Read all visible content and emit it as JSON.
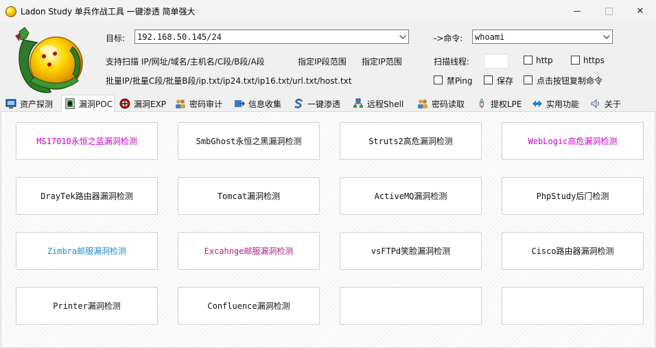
{
  "window": {
    "title": "Ladon Study 单兵作战工具 一键渗透 简单强大",
    "close_glyph": "✕"
  },
  "form": {
    "target_label": "目标:",
    "target_value": "192.168.50.145/24",
    "command_label": "->命令:",
    "command_value": "whoami",
    "support_text": "支持扫描 IP/网址/域名/主机名/C段/B段/A段",
    "ip_range_text": "指定IP段范围",
    "ip_range2_text": "指定IP范围",
    "batch_text": "批量IP/批量C段/批量B段/ip.txt/ip24.txt/ip16.txt/url.txt/host.txt",
    "threads_label": "扫描线程:",
    "http_label": "http",
    "https_label": "https",
    "noping_label": "禁Ping",
    "save_label": "保存",
    "copycmd_label": "点击按钮复制命令"
  },
  "tabs": [
    {
      "label": "资产探测",
      "icon": "monitor-icon"
    },
    {
      "label": "漏洞POC",
      "icon": "bug-icon"
    },
    {
      "label": "漏洞EXP",
      "icon": "exploit-icon"
    },
    {
      "label": "密码审计",
      "icon": "users-icon"
    },
    {
      "label": "信息收集",
      "icon": "collect-icon"
    },
    {
      "label": "一键渗透",
      "icon": "s-icon"
    },
    {
      "label": "远程Shell",
      "icon": "network-icon"
    },
    {
      "label": "密码读取",
      "icon": "users-key-icon"
    },
    {
      "label": "提权LPE",
      "icon": "rocket-icon"
    },
    {
      "label": "实用功能",
      "icon": "tools-icon"
    },
    {
      "label": "关于",
      "icon": "speaker-icon"
    }
  ],
  "colors": {
    "magenta": "#cc00cc",
    "purple": "#8a2be2",
    "cyan": "#1e90c8",
    "red_violet": "#b0208a"
  },
  "buttons": [
    {
      "label": "MS17010永恒之蓝漏洞检测",
      "color": "#cc00cc"
    },
    {
      "label": "SmbGhost永恒之黑漏洞检测",
      "color": "#111111"
    },
    {
      "label": "Struts2高危漏洞检测",
      "color": "#111111"
    },
    {
      "label": "WebLogic高危漏洞检测",
      "color": "#cc00cc"
    },
    {
      "label": "DrayTek路由器漏洞检测",
      "color": "#111111"
    },
    {
      "label": "Tomcat漏洞检测",
      "color": "#111111"
    },
    {
      "label": "ActiveMQ漏洞检测",
      "color": "#111111"
    },
    {
      "label": "PhpStudy后门检测",
      "color": "#111111"
    },
    {
      "label": "Zimbra邮服漏洞检测",
      "color": "#1e90c8"
    },
    {
      "label": "Excahnge邮服漏洞检测",
      "color": "#b0208a"
    },
    {
      "label": "vsFTPd笑脸漏洞检测",
      "color": "#111111"
    },
    {
      "label": "Cisco路由器漏洞检测",
      "color": "#111111"
    },
    {
      "label": "Printer漏洞检测",
      "color": "#111111"
    },
    {
      "label": "Confluence漏洞检测",
      "color": "#111111"
    },
    {
      "label": "",
      "color": "#111111"
    },
    {
      "label": "",
      "color": "#111111"
    }
  ]
}
